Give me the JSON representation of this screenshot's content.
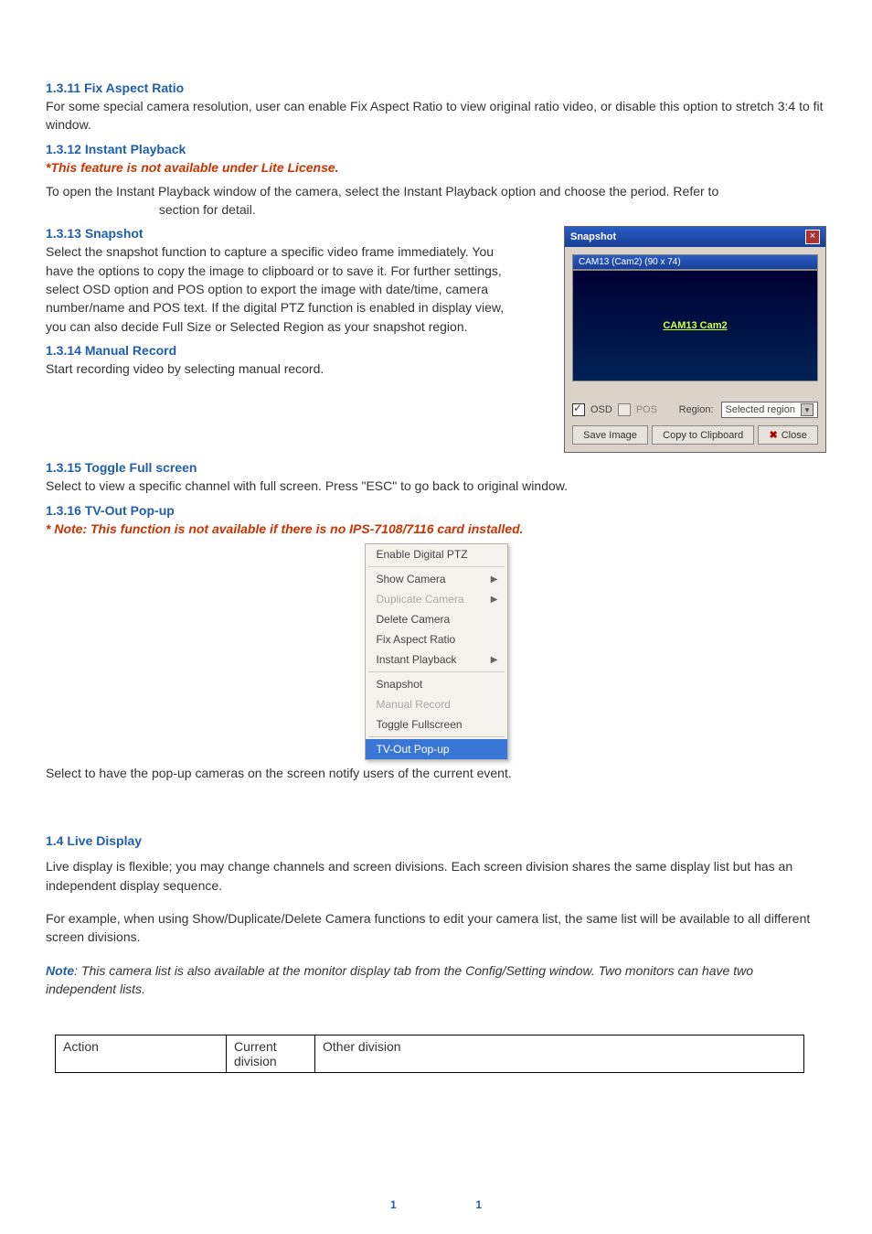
{
  "sections": {
    "s1": {
      "title": "1.3.11 Fix Aspect Ratio",
      "body": "For some special camera resolution, user can enable Fix Aspect Ratio to view original ratio video, or disable this option to stretch 3:4 to fit window."
    },
    "s2": {
      "title": "1.3.12 Instant Playback",
      "note": "*This feature is not available under Lite License.",
      "body_a": "To open the Instant Playback window of the camera, select the Instant Playback option and choose the period. Refer to",
      "body_b": "section for detail."
    },
    "s3": {
      "title": "1.3.13 Snapshot",
      "body": "Select the snapshot function to capture a specific video frame immediately. You have the options to copy the image to clipboard or to save it. For further settings, select OSD option and POS option to export the image with date/time, camera number/name and POS text. If the digital PTZ function is enabled in display view, you can also decide Full Size or Selected Region as your snapshot region."
    },
    "s4": {
      "title": "1.3.14 Manual Record",
      "body": "Start recording video by selecting manual record."
    },
    "s5": {
      "title": "1.3.15 Toggle Full screen",
      "body": "Select to view a specific channel with full screen. Press \"ESC\" to go back to original window."
    },
    "s6": {
      "title": "1.3.16 TV-Out Pop-up",
      "note": "* Note: This function is not available if there is no IPS-7108/7116 card installed.",
      "body": "Select to have the pop-up cameras on the screen notify users of the current event."
    },
    "s7": {
      "title": "1.4 Live Display",
      "p1": "Live display is flexible; you may change channels and screen divisions.   Each screen division shares the same display list but has an independent display sequence.",
      "p2": "For example, when using Show/Duplicate/Delete Camera functions to edit your camera list, the same list will be available to all different screen divisions.",
      "note_label": "Note",
      "p3": ": This camera list is also available at the monitor display tab from the Config/Setting window.   Two monitors can have two independent lists."
    }
  },
  "snapshot_dialog": {
    "title": "Snapshot",
    "preview_label": "CAM13 (Cam2) (90 x 74)",
    "preview_text": "CAM13 Cam2",
    "osd_label": "OSD",
    "pos_label": "POS",
    "region_label": "Region:",
    "region_value": "Selected region",
    "btn_save": "Save Image",
    "btn_copy": "Copy to Clipboard",
    "btn_close": "Close"
  },
  "context_menu": {
    "items": [
      {
        "label": "Enable Digital PTZ",
        "disabled": false,
        "sub": false,
        "hl": false
      },
      {
        "sep": true
      },
      {
        "label": "Show Camera",
        "disabled": false,
        "sub": true,
        "hl": false
      },
      {
        "label": "Duplicate Camera",
        "disabled": true,
        "sub": true,
        "hl": false
      },
      {
        "label": "Delete Camera",
        "disabled": false,
        "sub": false,
        "hl": false
      },
      {
        "label": "Fix Aspect Ratio",
        "disabled": false,
        "sub": false,
        "hl": false
      },
      {
        "label": "Instant Playback",
        "disabled": false,
        "sub": true,
        "hl": false
      },
      {
        "sep": true
      },
      {
        "label": "Snapshot",
        "disabled": false,
        "sub": false,
        "hl": false
      },
      {
        "label": "Manual Record",
        "disabled": true,
        "sub": false,
        "hl": false
      },
      {
        "label": "Toggle Fullscreen",
        "disabled": false,
        "sub": false,
        "hl": false
      },
      {
        "sep": true
      },
      {
        "label": "TV-Out Pop-up",
        "disabled": false,
        "sub": false,
        "hl": true
      }
    ]
  },
  "action_table": {
    "colA": "Action",
    "colB": "Current division",
    "colC": "Other division"
  },
  "footer": {
    "left": "1",
    "right": "1"
  }
}
